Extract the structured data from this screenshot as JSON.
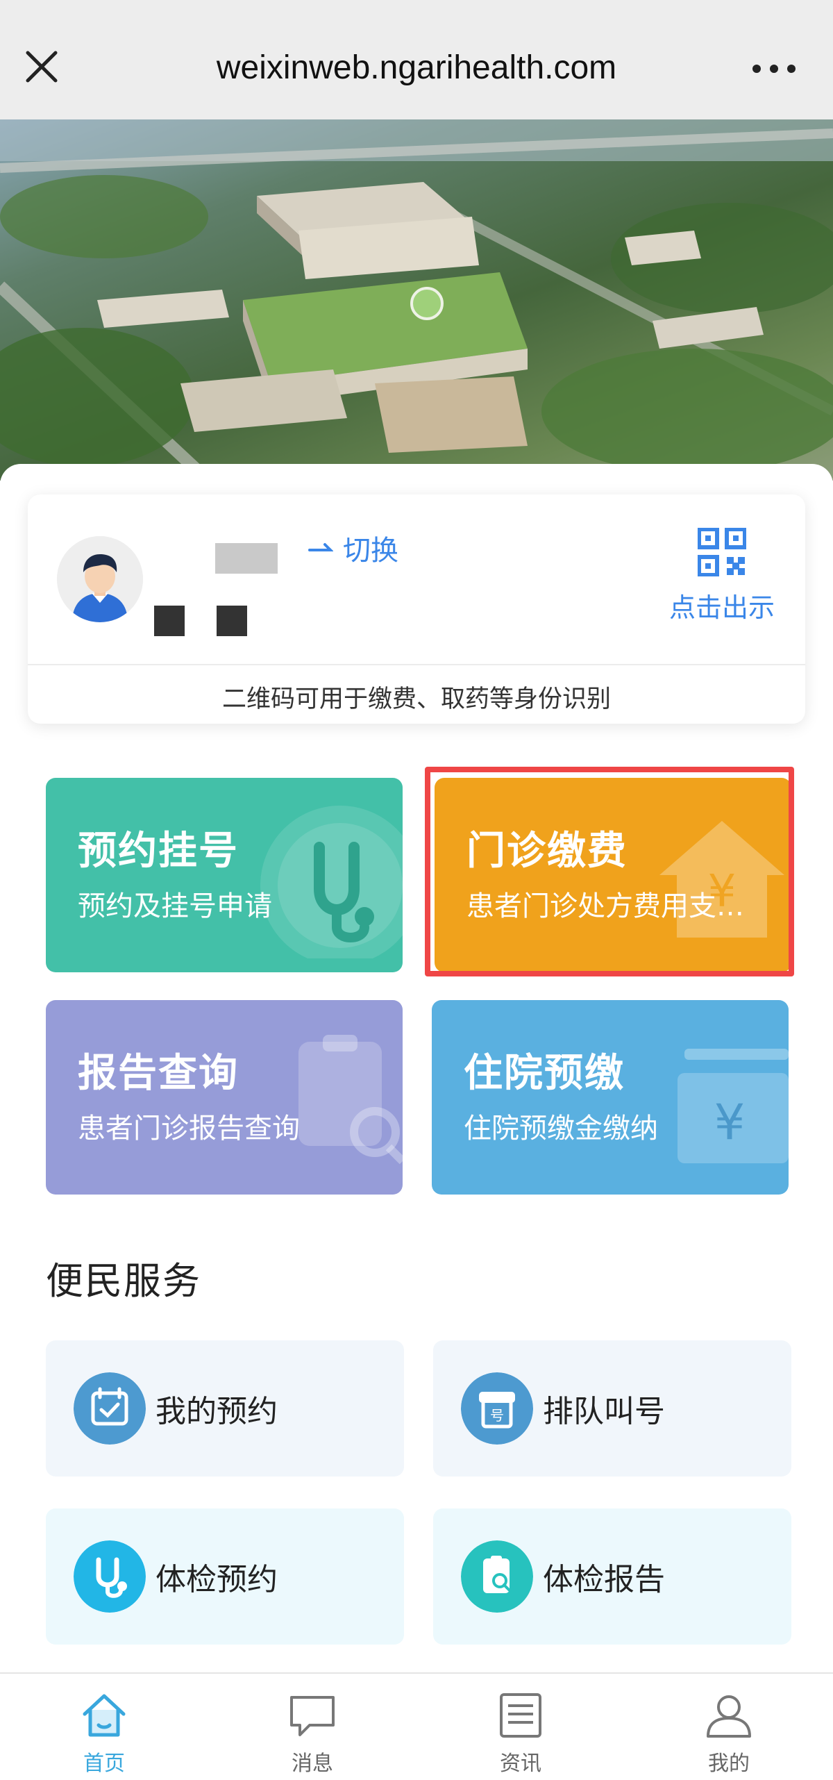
{
  "browser": {
    "url": "weixinweb.ngarihealth.com",
    "close_icon": "close-icon",
    "more_icon": "more-icon"
  },
  "patient_card": {
    "switch_label": "切换",
    "qr_label": "点击出示",
    "hint": "二维码可用于缴费、取药等身份识别"
  },
  "tiles": [
    {
      "title": "预约挂号",
      "subtitle": "预约及挂号申请",
      "icon": "stethoscope-icon",
      "color": "#43c0a8"
    },
    {
      "title": "门诊缴费",
      "subtitle": "患者门诊处方费用支…",
      "icon": "house-yen-icon",
      "color": "#f0a21c"
    },
    {
      "title": "报告查询",
      "subtitle": "患者门诊报告查询",
      "icon": "clipboard-search-icon",
      "color": "#969cd8"
    },
    {
      "title": "住院预缴",
      "subtitle": "住院预缴金缴纳",
      "icon": "yen-box-icon",
      "color": "#5ab0e0"
    }
  ],
  "section": {
    "title": "便民服务",
    "items": [
      {
        "label": "我的预约",
        "icon": "calendar-check-icon"
      },
      {
        "label": "排队叫号",
        "icon": "queue-ticket-icon"
      },
      {
        "label": "体检预约",
        "icon": "stethoscope-icon"
      },
      {
        "label": "体检报告",
        "icon": "report-search-icon"
      }
    ]
  },
  "bottom_nav": [
    {
      "label": "首页",
      "icon": "home-icon",
      "active": true
    },
    {
      "label": "消息",
      "icon": "message-icon",
      "active": false
    },
    {
      "label": "资讯",
      "icon": "news-icon",
      "active": false
    },
    {
      "label": "我的",
      "icon": "user-icon",
      "active": false
    }
  ]
}
